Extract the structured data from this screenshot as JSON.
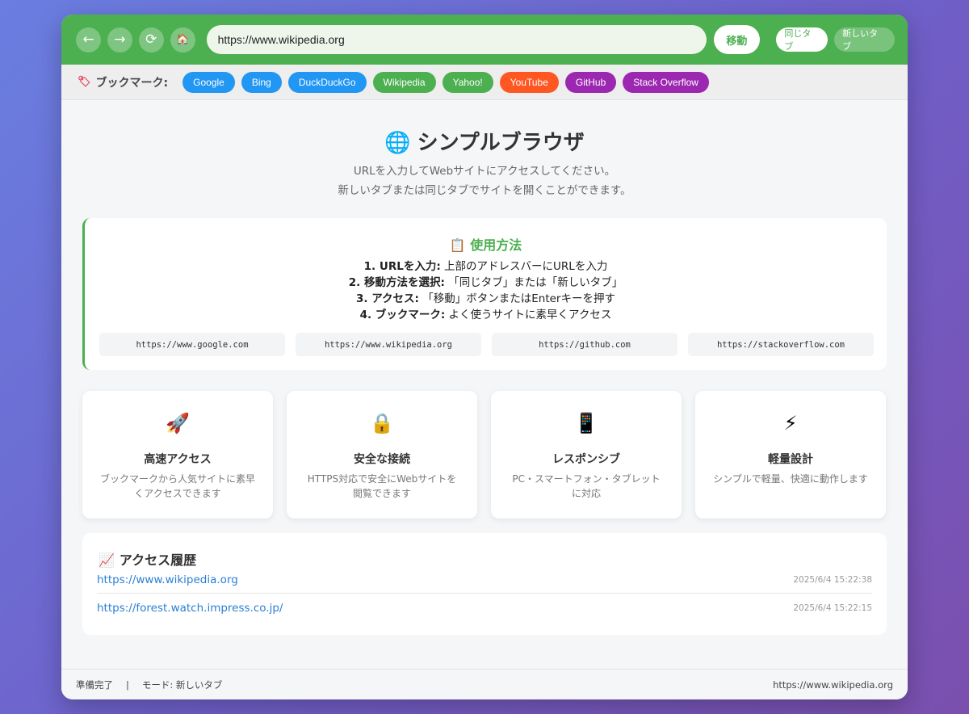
{
  "toolbar": {
    "back_icon": "←",
    "forward_icon": "→",
    "reload_icon": "⟳",
    "home_icon": "🏠",
    "address_value": "https://www.wikipedia.org",
    "go_label": "移動",
    "same_tab_label": "同じタブ",
    "new_tab_label": "新しいタブ",
    "accent": "#4caf50"
  },
  "bookmarks": {
    "label": "ブックマーク:",
    "icon": "tag-icon",
    "items": [
      {
        "label": "Google",
        "color": "#2196f3"
      },
      {
        "label": "Bing",
        "color": "#2196f3"
      },
      {
        "label": "DuckDuckGo",
        "color": "#2196f3"
      },
      {
        "label": "Wikipedia",
        "color": "#4caf50"
      },
      {
        "label": "Yahoo!",
        "color": "#4caf50"
      },
      {
        "label": "YouTube",
        "color": "#ff5722"
      },
      {
        "label": "GitHub",
        "color": "#9c27b0"
      },
      {
        "label": "Stack Overflow",
        "color": "#9c27b0"
      }
    ]
  },
  "hero": {
    "title": "シンプルブラウザ",
    "subtitle_1": "URLを入力してWebサイトにアクセスしてください。",
    "subtitle_2": "新しいタブまたは同じタブでサイトを開くことができます。"
  },
  "usage": {
    "title": "使用方法",
    "steps": [
      {
        "head": "1. URLを入力:",
        "text": " 上部のアドレスバーにURLを入力"
      },
      {
        "head": "2. 移動方法を選択:",
        "text": " 「同じタブ」または「新しいタブ」"
      },
      {
        "head": "3. アクセス:",
        "text": " 「移動」ボタンまたはEnterキーを押す"
      },
      {
        "head": "4. ブックマーク:",
        "text": " よく使うサイトに素早くアクセス"
      }
    ],
    "examples": [
      "https://www.google.com",
      "https://www.wikipedia.org",
      "https://github.com",
      "https://stackoverflow.com"
    ]
  },
  "features": [
    {
      "icon": "🚀",
      "title": "高速アクセス",
      "desc": "ブックマークから人気サイトに素早くアクセスできます"
    },
    {
      "icon": "🔒",
      "title": "安全な接続",
      "desc": "HTTPS対応で安全にWebサイトを閲覧できます"
    },
    {
      "icon": "📱",
      "title": "レスポンシブ",
      "desc": "PC・スマートフォン・タブレットに対応"
    },
    {
      "icon": "⚡",
      "title": "軽量設計",
      "desc": "シンプルで軽量、快適に動作します"
    }
  ],
  "history": {
    "title": "アクセス履歴",
    "items": [
      {
        "url": "https://www.wikipedia.org",
        "time": "2025/6/4 15:22:38"
      },
      {
        "url": "https://forest.watch.impress.co.jp/",
        "time": "2025/6/4 15:22:15"
      }
    ]
  },
  "status": {
    "state": "準備完了",
    "separator": "|",
    "mode": "モード: 新しいタブ",
    "url": "https://www.wikipedia.org"
  }
}
